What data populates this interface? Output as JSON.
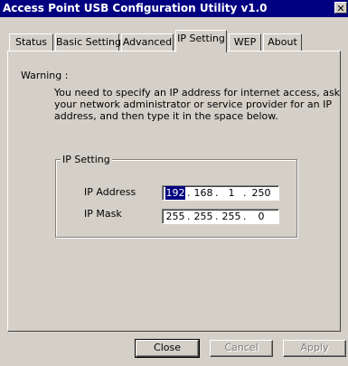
{
  "window": {
    "title": "Access Point USB Configuration Utility v1.0",
    "close_glyph": "✕"
  },
  "tabs": [
    {
      "label": "Status",
      "active": false
    },
    {
      "label": "Basic Setting",
      "active": false
    },
    {
      "label": "Advanced",
      "active": false
    },
    {
      "label": "IP Setting",
      "active": true
    },
    {
      "label": "WEP",
      "active": false
    },
    {
      "label": "About",
      "active": false
    }
  ],
  "warning": {
    "label": "Warning :",
    "text": "You need to specify an IP address for internet access, ask your network administrator or service provider for an IP address, and then type it in the space below."
  },
  "ip_group": {
    "title": "IP Setting",
    "ip_address": {
      "label": "IP Address",
      "octets": [
        "192",
        "168",
        "1",
        "250"
      ],
      "selected_octet": 0
    },
    "ip_mask": {
      "label": "IP Mask",
      "octets": [
        "255",
        "255",
        "255",
        "0"
      ]
    }
  },
  "buttons": {
    "close": "Close",
    "cancel": "Cancel",
    "apply": "Apply"
  }
}
